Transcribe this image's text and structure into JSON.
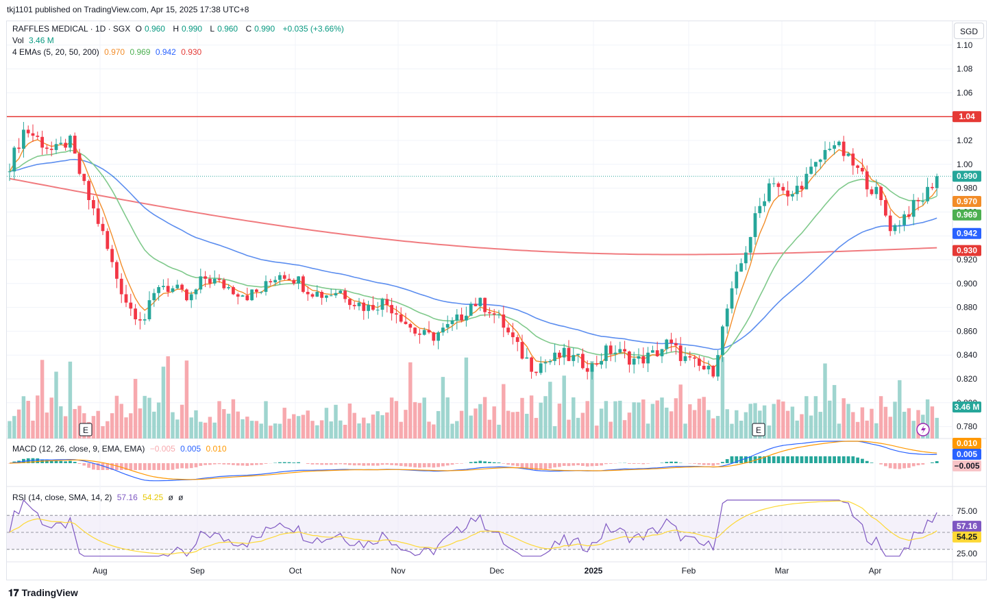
{
  "publish_line": "tkj1101 published on TradingView.com, Apr 15, 2025 17:38 UTC+8",
  "currency_button": "SGD",
  "footer_brand": "TradingView",
  "legend": {
    "symbol": "RAFFLES MEDICAL · 1D · SGX",
    "o_label": "O",
    "o_value": "0.960",
    "h_label": "H",
    "h_value": "0.990",
    "l_label": "L",
    "l_value": "0.960",
    "c_label": "C",
    "c_value": "0.990",
    "change": "+0.035 (+3.66%)",
    "vol_label": "Vol",
    "vol_value": "3.46 M",
    "ema_label": "4 EMAs (5, 20, 50, 200)",
    "ema5": "0.970",
    "ema20": "0.969",
    "ema50": "0.942",
    "ema200": "0.930",
    "macd_label": "MACD (12, 26, close, 9, EMA, EMA)",
    "macd_hist": "−0.005",
    "macd_line": "0.005",
    "macd_signal": "0.010",
    "rsi_label": "RSI (14, close, SMA, 14, 2)",
    "rsi_value": "57.16",
    "rsi_ma": "54.25",
    "rsi_extra1": "ø",
    "rsi_extra2": "ø"
  },
  "colors": {
    "up": "#26a69a",
    "down": "#f23645",
    "up_vol": "#9fd5cf",
    "down_vol": "#f7a9ae",
    "ema5": "#f28c28",
    "ema20": "#7fc98b",
    "ema50": "#5b8def",
    "ema200": "#f07a7e",
    "resistance": "#e53935",
    "macd": "#2962ff",
    "signal": "#ff9800",
    "rsi": "#7e57c2",
    "rsi_ma": "#fdd835"
  },
  "chart_data": {
    "type": "candlestick",
    "price_axis_ticks": [
      "1.10",
      "1.08",
      "1.06",
      "1.04",
      "1.02",
      "1.00",
      "0.980",
      "0.960",
      "0.940",
      "0.920",
      "0.900",
      "0.880",
      "0.860",
      "0.840",
      "0.820",
      "0.800",
      "0.780"
    ],
    "time_axis_ticks": [
      "Aug",
      "Sep",
      "Oct",
      "Nov",
      "Dec",
      "2025",
      "Feb",
      "Mar",
      "Apr"
    ],
    "resistance_level": 1.04,
    "price_badges": {
      "resistance": "1.04",
      "last": "0.990",
      "ema5": "0.970",
      "ema20": "0.969",
      "ema50": "0.942",
      "ema200": "0.930",
      "volume": "3.46 M",
      "macd_signal": "0.010",
      "macd_line": "0.005",
      "macd_hist": "−0.005",
      "rsi": "57.16",
      "rsi_ma": "54.25"
    },
    "rsi_axis_ticks": [
      "75.00",
      "25.00"
    ],
    "rsi_levels": [
      70,
      30
    ],
    "earnings_markers": [
      "E",
      "E"
    ],
    "keyframes_close": [
      1.0,
      1.03,
      1.02,
      1.01,
      1.02,
      0.98,
      0.95,
      0.91,
      0.88,
      0.87,
      0.9,
      0.895,
      0.885,
      0.905,
      0.9,
      0.895,
      0.89,
      0.895,
      0.91,
      0.905,
      0.895,
      0.89,
      0.895,
      0.885,
      0.88,
      0.885,
      0.875,
      0.86,
      0.855,
      0.86,
      0.87,
      0.885,
      0.88,
      0.865,
      0.845,
      0.83,
      0.835,
      0.84,
      0.835,
      0.83,
      0.845,
      0.84,
      0.835,
      0.84,
      0.85,
      0.838,
      0.83,
      0.825,
      0.88,
      0.92,
      0.96,
      0.99,
      0.97,
      0.985,
      1.0,
      1.02,
      1.005,
      0.99,
      0.975,
      0.945,
      0.96,
      0.97,
      0.99
    ],
    "ema200_start": 0.988,
    "ema200_end": 0.93
  }
}
